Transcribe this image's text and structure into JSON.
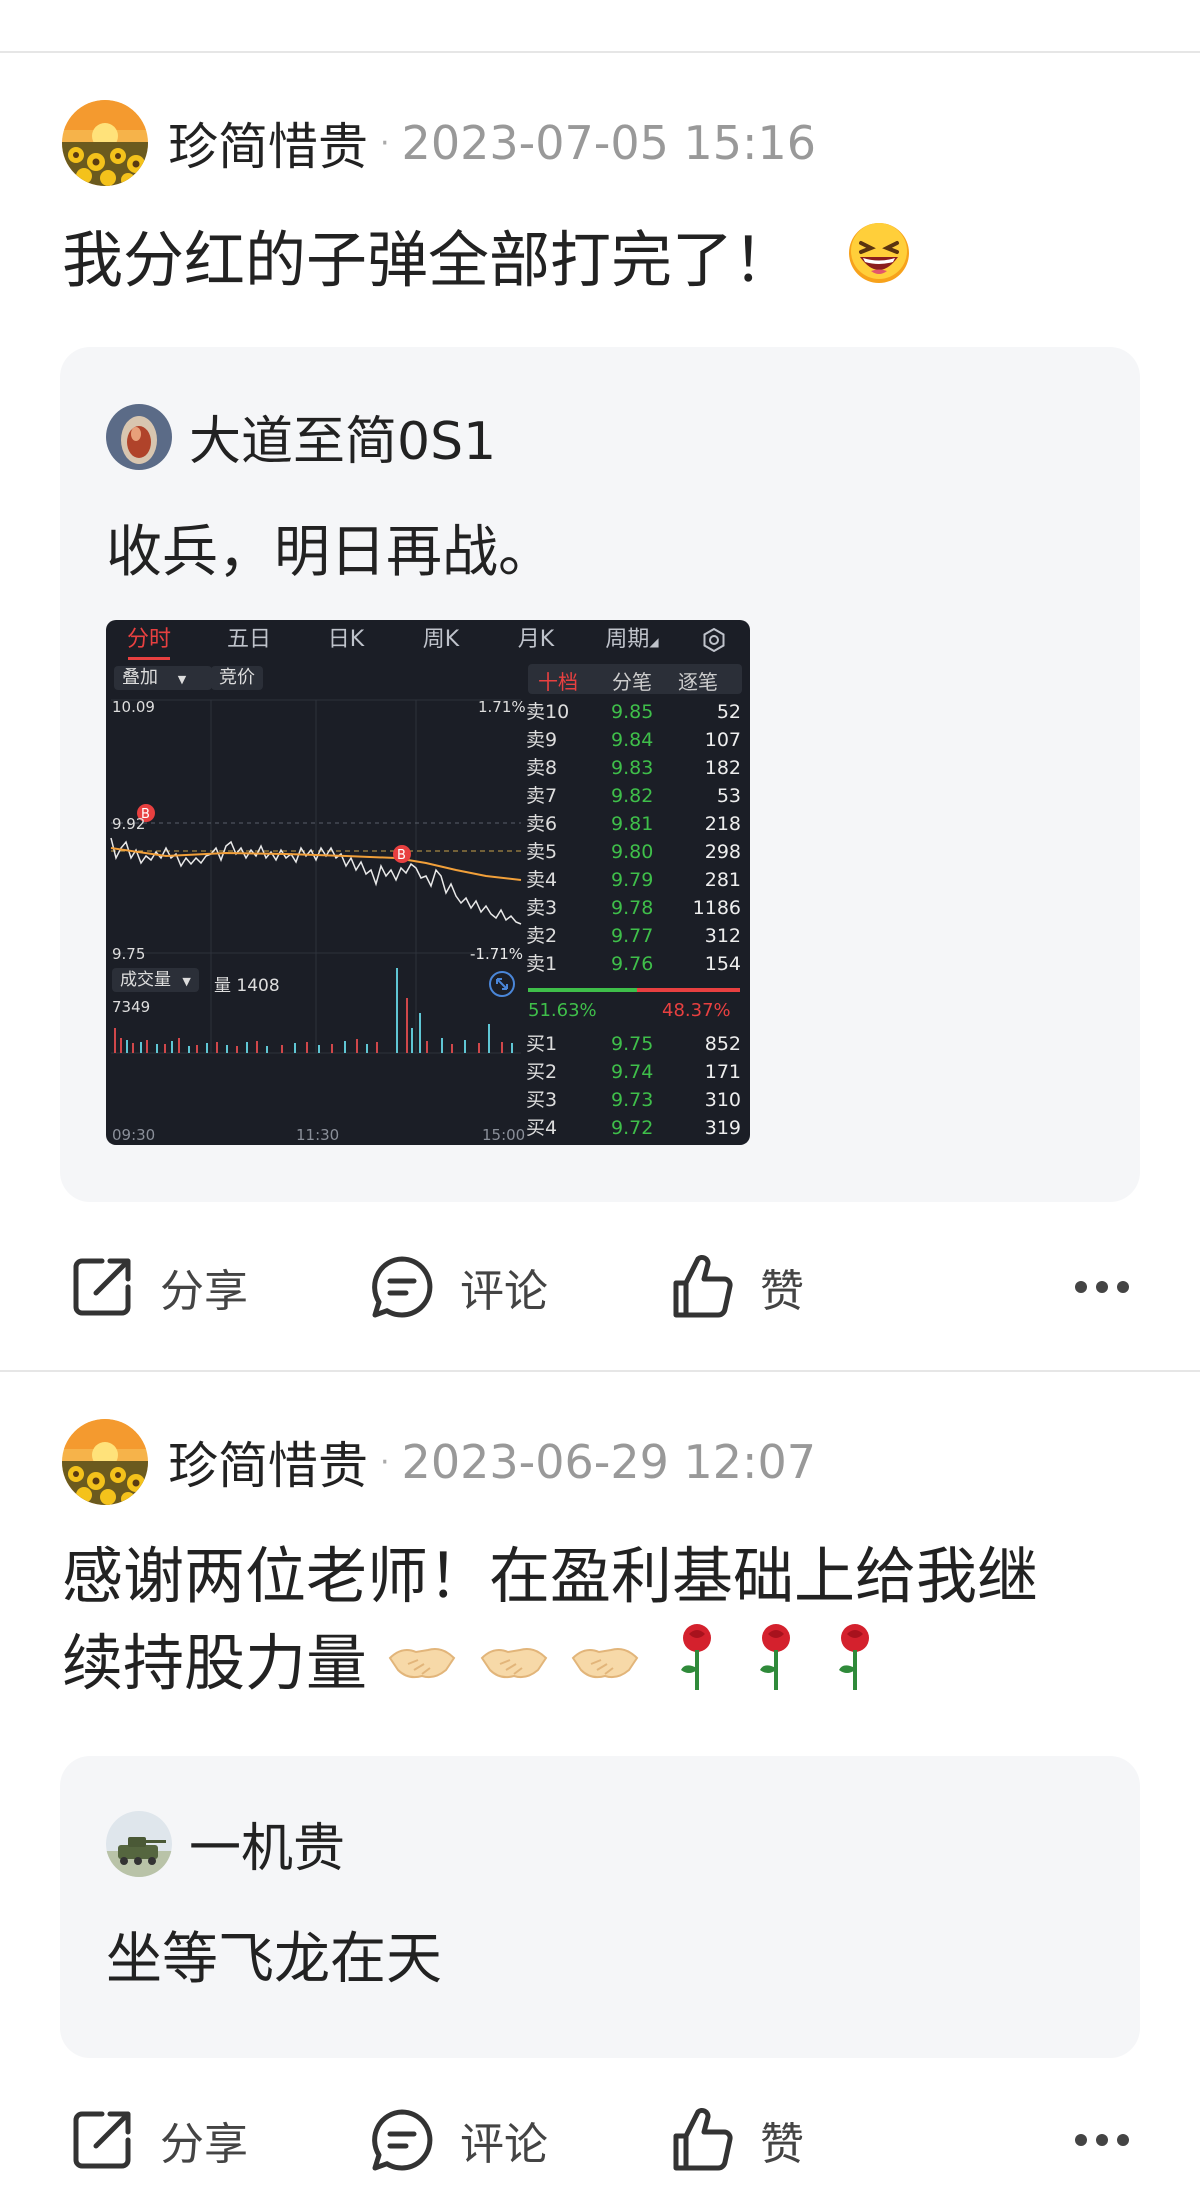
{
  "posts": [
    {
      "author": "珍简惜贵",
      "time": "2023-07-05 15:16",
      "text": "我分红的子弹全部打完了！",
      "quote": {
        "author": "大道至简0S1",
        "text": "收兵，明日再战。",
        "stock_chart": {
          "tabs": [
            "分时",
            "五日",
            "日K",
            "周K",
            "月K",
            "周期"
          ],
          "overlay_label": "叠加",
          "auction_label": "竞价",
          "book_tabs": [
            "十档",
            "分笔",
            "逐笔"
          ],
          "price_high": "10.09",
          "price_mid": "9.92",
          "price_low": "9.75",
          "pct_high": "1.71%",
          "pct_low": "-1.71%",
          "volume_label": "成交量",
          "volume_text": "量 1408",
          "volume_max": "7349",
          "time_start": "09:30",
          "time_mid": "11:30",
          "time_end": "15:00",
          "asks": [
            {
              "name": "卖10",
              "price": "9.85",
              "vol": "52"
            },
            {
              "name": "卖9",
              "price": "9.84",
              "vol": "107"
            },
            {
              "name": "卖8",
              "price": "9.83",
              "vol": "182"
            },
            {
              "name": "卖7",
              "price": "9.82",
              "vol": "53"
            },
            {
              "name": "卖6",
              "price": "9.81",
              "vol": "218"
            },
            {
              "name": "卖5",
              "price": "9.80",
              "vol": "298"
            },
            {
              "name": "卖4",
              "price": "9.79",
              "vol": "281"
            },
            {
              "name": "卖3",
              "price": "9.78",
              "vol": "1186"
            },
            {
              "name": "卖2",
              "price": "9.77",
              "vol": "312"
            },
            {
              "name": "卖1",
              "price": "9.76",
              "vol": "154"
            }
          ],
          "buy_pct": "51.63%",
          "sell_pct": "48.37%",
          "bids": [
            {
              "name": "买1",
              "price": "9.75",
              "vol": "852"
            },
            {
              "name": "买2",
              "price": "9.74",
              "vol": "171"
            },
            {
              "name": "买3",
              "price": "9.73",
              "vol": "310"
            },
            {
              "name": "买4",
              "price": "9.72",
              "vol": "319"
            }
          ]
        }
      },
      "actions": {
        "share": "分享",
        "comment": "评论",
        "like": "赞"
      }
    },
    {
      "author": "珍简惜贵",
      "time": "2023-06-29 12:07",
      "text_line1": "感谢两位老师！在盈利基础上给我继",
      "text_line2": "续持股力量",
      "quote": {
        "author": "一机贵",
        "text": "坐等飞龙在天"
      },
      "actions": {
        "share": "分享",
        "comment": "评论",
        "like": "赞"
      }
    }
  ],
  "colors": {
    "accent_red": "#e84040",
    "green": "#3fbf4a",
    "muted": "#999999"
  }
}
